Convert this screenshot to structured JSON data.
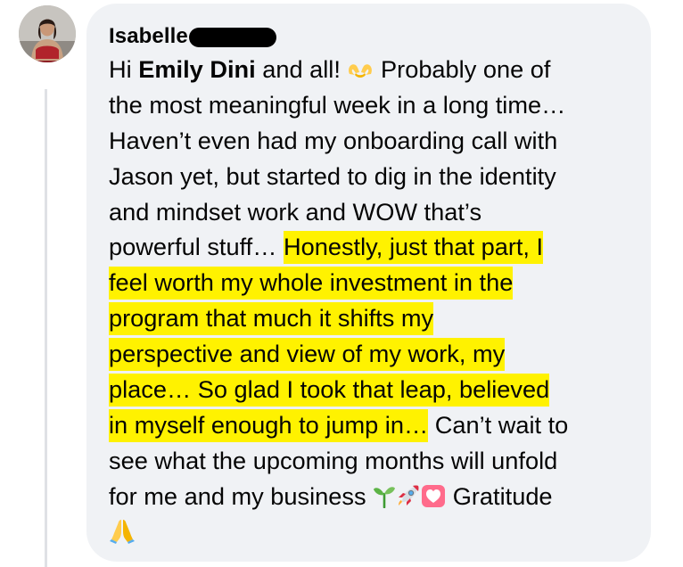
{
  "comment": {
    "author_name": "Isabelle",
    "lines": [
      {
        "segments": [
          {
            "text": "Hi ",
            "style": "normal"
          },
          {
            "text": "Emily Dini",
            "style": "bold"
          },
          {
            "text": " and all! ",
            "style": "normal"
          },
          {
            "emoji": "heart-hands-icon"
          },
          {
            "text": " Probably one of",
            "style": "normal"
          }
        ]
      },
      {
        "segments": [
          {
            "text": "the most meaningful week in a long time…",
            "style": "normal"
          }
        ]
      },
      {
        "segments": [
          {
            "text": "Haven’t even had my onboarding call with",
            "style": "normal"
          }
        ]
      },
      {
        "segments": [
          {
            "text": "Jason yet, but started to dig in the identity",
            "style": "normal"
          }
        ]
      },
      {
        "segments": [
          {
            "text": "and mindset work and WOW that’s",
            "style": "normal"
          }
        ]
      },
      {
        "segments": [
          {
            "text": "powerful stuff… ",
            "style": "normal"
          },
          {
            "text": "Honestly, just that part, I",
            "style": "highlight"
          }
        ]
      },
      {
        "segments": [
          {
            "text": "feel worth my whole investment in the",
            "style": "highlight"
          }
        ]
      },
      {
        "segments": [
          {
            "text": "program that much it shifts my",
            "style": "highlight"
          }
        ]
      },
      {
        "segments": [
          {
            "text": "perspective and view of my work, my",
            "style": "highlight"
          }
        ]
      },
      {
        "segments": [
          {
            "text": "place… So glad I took that leap, believed",
            "style": "highlight"
          }
        ]
      },
      {
        "segments": [
          {
            "text": "in myself enough to jump in…",
            "style": "highlight"
          },
          {
            "text": " Can’t wait to",
            "style": "normal"
          }
        ]
      },
      {
        "segments": [
          {
            "text": "see what the upcoming months will unfold",
            "style": "normal"
          }
        ]
      },
      {
        "segments": [
          {
            "text": "for me and my business ",
            "style": "normal"
          },
          {
            "emoji": "seedling-icon"
          },
          {
            "emoji": "rocket-icon"
          },
          {
            "emoji": "heart-box-icon"
          },
          {
            "text": " Gratitude",
            "style": "normal"
          }
        ]
      },
      {
        "segments": [
          {
            "emoji": "folded-hands-icon"
          }
        ]
      }
    ]
  },
  "colors": {
    "bubble_background": "#f0f2f5",
    "highlight": "#fff200",
    "text": "#050505",
    "thread_line": "#dfe1e5"
  }
}
